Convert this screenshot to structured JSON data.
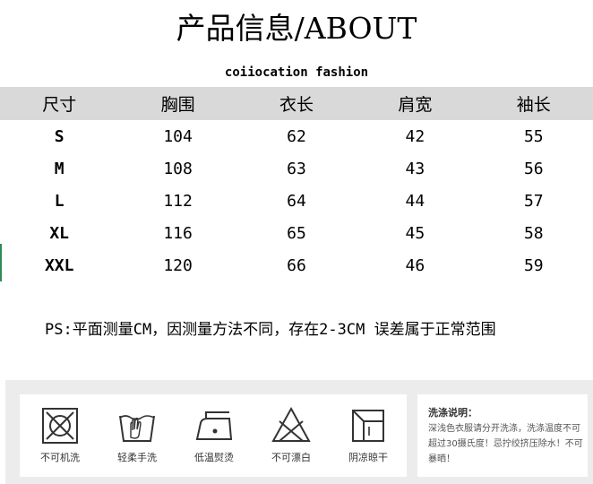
{
  "header": {
    "title": "产品信息/ABOUT",
    "subtitle": "coiiocation fashion"
  },
  "size_table": {
    "columns": [
      "尺寸",
      "胸围",
      "衣长",
      "肩宽",
      "袖长"
    ],
    "rows": [
      [
        "S",
        "104",
        "62",
        "42",
        "55"
      ],
      [
        "M",
        "108",
        "63",
        "43",
        "56"
      ],
      [
        "L",
        "112",
        "64",
        "44",
        "57"
      ],
      [
        "XL",
        "116",
        "65",
        "45",
        "58"
      ],
      [
        "XXL",
        "120",
        "66",
        "46",
        "59"
      ]
    ]
  },
  "note": "PS:平面测量CM，因测量方法不同，存在2-3CM 误差属于正常范围",
  "care": {
    "items": [
      {
        "icon": "no-machine-wash-icon",
        "label": "不可机洗"
      },
      {
        "icon": "gentle-hand-wash-icon",
        "label": "轻柔手洗"
      },
      {
        "icon": "low-temp-iron-icon",
        "label": "低温熨烫"
      },
      {
        "icon": "no-bleach-icon",
        "label": "不可漂白"
      },
      {
        "icon": "shade-dry-icon",
        "label": "阴凉晾干"
      }
    ],
    "instructions_title": "洗涤说明：",
    "instructions_body": "深浅色衣服请分开洗涤，洗涤温度不可超过30摄氏度！忌拧绞挤压除水！不可暴晒！"
  },
  "colors": {
    "header_band": "#d9d9d9",
    "care_panel": "#ececec",
    "left_marker": "#2e8b57"
  }
}
